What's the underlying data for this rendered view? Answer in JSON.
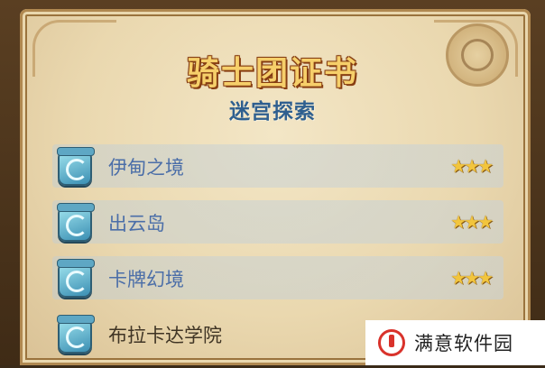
{
  "header": {
    "title": "骑士团证书",
    "subtitle": "迷宫探索"
  },
  "entries": [
    {
      "name": "伊甸之境",
      "stars": "★★★",
      "completed": true
    },
    {
      "name": "出云岛",
      "stars": "★★★",
      "completed": true
    },
    {
      "name": "卡牌幻境",
      "stars": "★★★",
      "completed": true
    },
    {
      "name": "布拉卡达学院",
      "stars": "",
      "completed": false
    }
  ],
  "watermark": {
    "text": "满意软件园"
  },
  "colors": {
    "title": "#f6cf6a",
    "subtitle": "#2f5f8f",
    "entry": "#4b6ea8",
    "star": "#f2c53d"
  },
  "icons": {
    "entry_badge": "portal-icon",
    "watermark_logo": "brand-logo-icon"
  }
}
